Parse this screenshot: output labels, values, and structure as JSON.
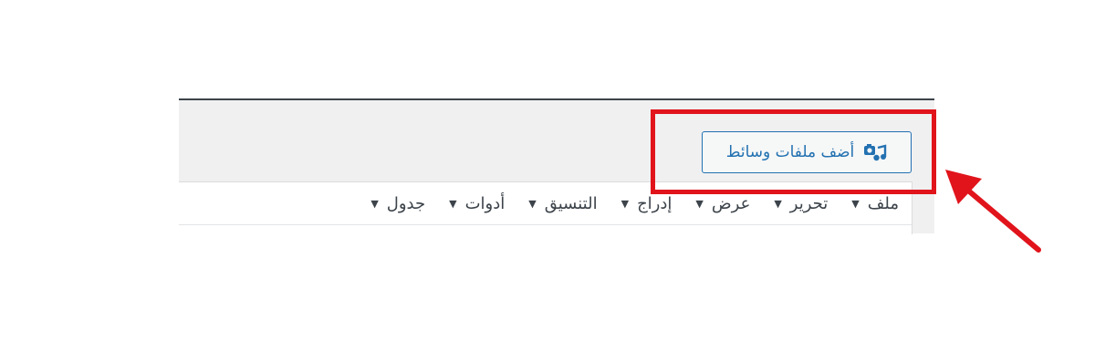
{
  "media_button": {
    "label": "أضف ملفات وسائط",
    "icon": "add-media-icon",
    "color": "#2271b1"
  },
  "menubar": {
    "items": [
      {
        "label": "ملف"
      },
      {
        "label": "تحرير"
      },
      {
        "label": "عرض"
      },
      {
        "label": "إدراج"
      },
      {
        "label": "التنسيق"
      },
      {
        "label": "أدوات"
      },
      {
        "label": "جدول"
      }
    ],
    "caret_icon": "caret-down-icon"
  },
  "annotation": {
    "highlight_color": "#e1141c",
    "arrow_icon": "red-arrow-icon"
  }
}
